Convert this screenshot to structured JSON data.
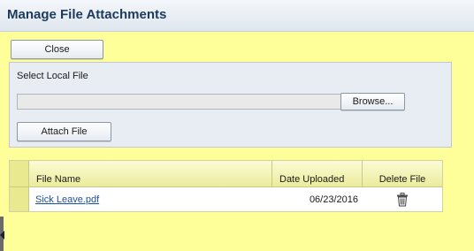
{
  "dialog": {
    "title": "Manage File Attachments"
  },
  "buttons": {
    "close": "Close",
    "browse": "Browse...",
    "attach": "Attach File"
  },
  "upload": {
    "label": "Select Local File",
    "file_value": ""
  },
  "table": {
    "columns": {
      "file_name": "File Name",
      "date_uploaded": "Date Uploaded",
      "delete_file": "Delete File"
    },
    "rows": [
      {
        "file_name": "Sick Leave.pdf",
        "date_uploaded": "06/23/2016",
        "delete_icon": "trash-icon"
      }
    ]
  }
}
